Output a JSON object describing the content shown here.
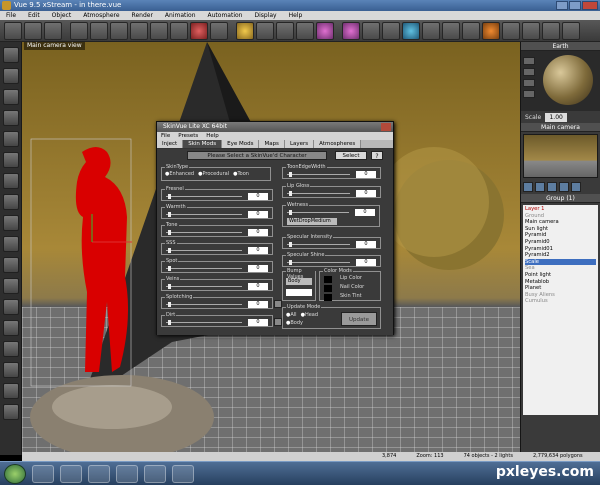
{
  "window": {
    "title": "Vue 9.5 xStream - in there.vue",
    "menu": [
      "File",
      "Edit",
      "Object",
      "Atmosphere",
      "Render",
      "Animation",
      "Automation",
      "Display",
      "Help"
    ]
  },
  "viewport": {
    "title": "Main camera view"
  },
  "right_panel": {
    "earth_title": "Earth",
    "scale_label": "Scale",
    "scale_value": "1.00",
    "camera_title": "Main camera",
    "layers_header": "Group (1)",
    "layers": [
      {
        "label": "Layer 1",
        "style": "red"
      },
      {
        "label": "Ground",
        "style": "gray"
      },
      {
        "label": "Main camera",
        "style": ""
      },
      {
        "label": "Sun light",
        "style": ""
      },
      {
        "label": "Pyramid",
        "style": ""
      },
      {
        "label": "Pyramid0",
        "style": ""
      },
      {
        "label": "Pyramid01",
        "style": ""
      },
      {
        "label": "Pyramid2",
        "style": ""
      },
      {
        "label": "Scale",
        "style": "sel"
      },
      {
        "label": "Sea",
        "style": "gray"
      },
      {
        "label": "Point light",
        "style": ""
      },
      {
        "label": "Metablob",
        "style": ""
      },
      {
        "label": "Planet",
        "style": ""
      },
      {
        "label": "Busy Aliens",
        "style": "gray"
      },
      {
        "label": "Cumulus",
        "style": "gray"
      }
    ]
  },
  "status": {
    "zoom": "Zoom: 113",
    "objects": "74 objects - 2 lights",
    "polygons": "2,779,634 polygons",
    "pos": "3,874"
  },
  "watermark": "pxleyes.com",
  "dialog": {
    "title": "SkinVue Lite XC 64bit",
    "menu": [
      "File",
      "Presets",
      "Help"
    ],
    "tabs": [
      "Inject",
      "Skin Mods",
      "Eye Mods",
      "Maps",
      "Layers",
      "Atmospheres"
    ],
    "active_tab": 1,
    "select_bar": "Please Select a SkinVue'd Character",
    "select_button": "Select",
    "help_button": "?",
    "skin_type_label": "SkinType",
    "skin_types": [
      "Enhanced",
      "Procedural",
      "Toon"
    ],
    "left_groups": [
      "Fresnel",
      "Warmth",
      "Tone",
      "SSS",
      "Spot",
      "Veins",
      "Splotching",
      "Dirt"
    ],
    "right_groups": [
      "ToonEdgeWidth",
      "Lip Gloss",
      "Wetness",
      "Specular Intensity",
      "Specular Shine"
    ],
    "wetness_dropdown": "WetDropMedium",
    "bump_label": "Bump Values",
    "bump_dropdown": "Body",
    "color_mods_label": "Color Mods",
    "color_mods": [
      "Lip Color",
      "Nail Color",
      "Skin Tint"
    ],
    "update_mode_label": "Update Mode",
    "update_modes": [
      "All",
      "Head",
      "Body"
    ],
    "update_button": "Update",
    "zero": "0"
  }
}
